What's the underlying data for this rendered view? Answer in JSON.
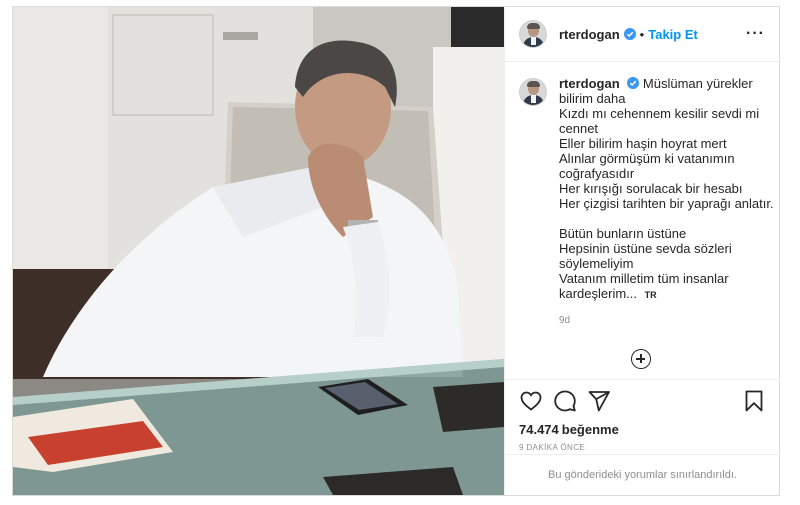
{
  "post": {
    "username": "rterdogan",
    "follow_label": "Takip Et",
    "separator": "•",
    "more_label": "···",
    "caption_lines": [
      "Müslüman yürekler",
      "bilirim daha",
      "Kızdı mı cehennem kesilir sevdi mi",
      "cennet",
      "Eller bilirim haşin hoyrat mert",
      "Alınlar görmüşüm ki vatanımın",
      "coğrafyasıdır",
      "Her kırışığı sorulacak bir hesabı",
      "Her çizgisi tarihten bir yaprağı anlatır."
    ],
    "caption_lines_2": [
      "Bütün bunların üstüne",
      "Hepsinin üstüne sevda sözleri",
      "söylemeliyim",
      "Vatanım milletim tüm insanlar",
      "kardeşlerim..."
    ],
    "translate_badge": "TR",
    "time_ago": "9d",
    "likes_count": "74.474",
    "likes_word": "beğenme",
    "post_time": "9 DAKİKA ÖNCE",
    "comments_limited": "Bu gönderideki yorumlar sınırlandırıldı."
  },
  "colors": {
    "accent": "#0095f6",
    "verified": "#3897f0",
    "muted": "#8e8e8e",
    "text": "#262626"
  },
  "icons": [
    "verified-badge-icon",
    "more-options-icon",
    "add-comment-icon",
    "heart-icon",
    "comment-icon",
    "share-icon",
    "bookmark-icon"
  ]
}
